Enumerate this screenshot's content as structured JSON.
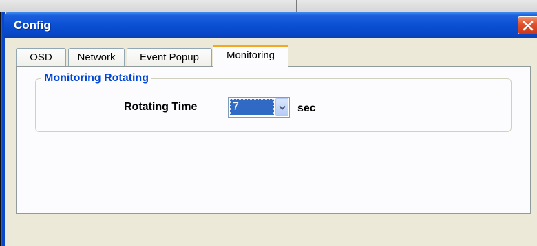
{
  "window": {
    "title": "Config",
    "close_icon": "close-icon"
  },
  "tabs": [
    {
      "label": "OSD",
      "active": false
    },
    {
      "label": "Network",
      "active": false
    },
    {
      "label": "Event Popup",
      "active": false
    },
    {
      "label": "Monitoring",
      "active": true
    }
  ],
  "monitoring": {
    "group_title": "Monitoring Rotating",
    "rotating_time_label": "Rotating Time",
    "rotating_time_value": "7",
    "dropdown_icon": "chevron-down-icon",
    "unit": "sec"
  },
  "colors": {
    "titlebar": "#0a4fd3",
    "close_button": "#e0502a",
    "group_title": "#0046d5",
    "selection": "#316ac5",
    "active_tab_accent": "#f5a623"
  }
}
